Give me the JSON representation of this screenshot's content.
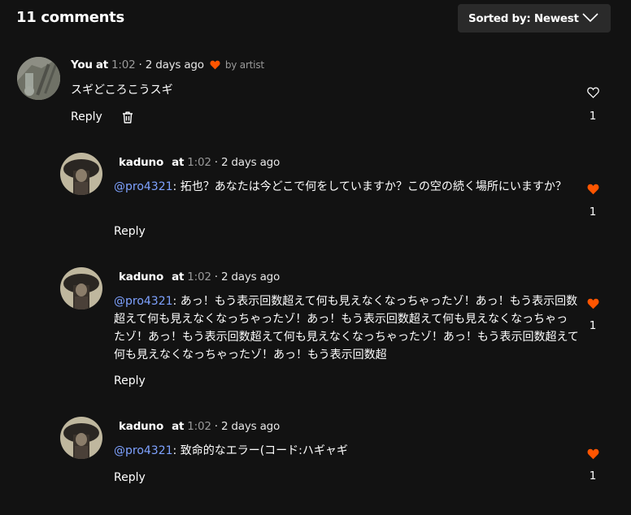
{
  "header": {
    "title": "11 comments",
    "sort_label": "Sorted by: Newest"
  },
  "colors": {
    "background": "#121212",
    "heart_accent": "#ff5500",
    "mention": "#7ea2ff",
    "timestamp": "#9a9a9a"
  },
  "comments": [
    {
      "author": "You",
      "at": "at",
      "timestamp": "1:02",
      "ago": "· 2 days ago",
      "liked_by_artist": true,
      "by_artist": "by artist",
      "mention": "",
      "text": "スギどころこうスギ",
      "reply_label": "Reply",
      "has_delete": true,
      "liked": false,
      "likes": "1"
    },
    {
      "author": "kaduno",
      "at": "at",
      "timestamp": "1:02",
      "ago": "· 2 days ago",
      "mention": "@pro4321",
      "text": ": 拓也？あなたは今どこで何をしていますか？この空の続く場所にいますか？",
      "reply_label": "Reply",
      "liked": true,
      "likes": "1"
    },
    {
      "author": "kaduno",
      "at": "at",
      "timestamp": "1:02",
      "ago": "· 2 days ago",
      "mention": "@pro4321",
      "text": ": あっ！もう表示回数超えて何も見えなくなっちゃったゾ！あっ！もう表示回数超えて何も見えなくなっちゃったゾ！あっ！もう表示回数超えて何も見えなくなっちゃったゾ！あっ！もう表示回数超えて何も見えなくなっちゃったゾ！あっ！もう表示回数超えて何も見えなくなっちゃったゾ！あっ！もう表示回数超",
      "reply_label": "Reply",
      "liked": true,
      "likes": "1"
    },
    {
      "author": "kaduno",
      "at": "at",
      "timestamp": "1:02",
      "ago": "· 2 days ago",
      "mention": "@pro4321",
      "text": ": 致命的なエラー(コード:ハギャギ",
      "reply_label": "Reply",
      "liked": true,
      "likes": "1"
    }
  ]
}
